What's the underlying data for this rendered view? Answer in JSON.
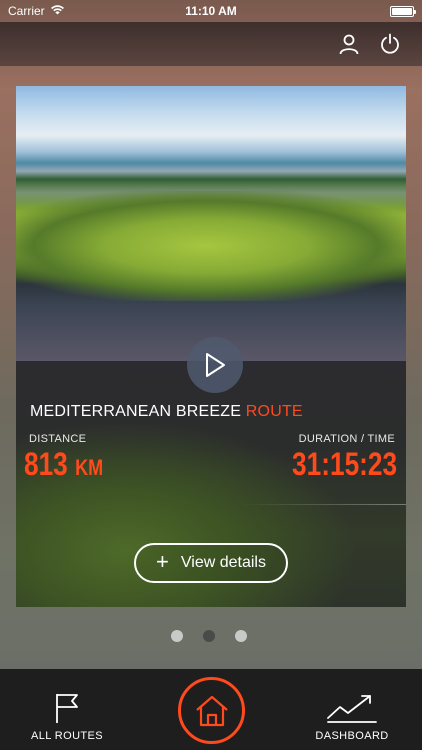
{
  "status_bar": {
    "carrier": "Carrier",
    "time": "11:10 AM"
  },
  "header": {
    "profile_icon": "person-icon",
    "power_icon": "power-icon"
  },
  "card": {
    "route_name": "MEDITERRANEAN BREEZE",
    "route_suffix": "ROUTE",
    "distance_label": "DISTANCE",
    "distance_value": "813",
    "distance_unit": "KM",
    "duration_label": "DURATION / TIME",
    "duration_value": "31:15:23",
    "details_label": "View details",
    "play_icon": "play-icon"
  },
  "pager": {
    "count": 3,
    "active_index": 1
  },
  "tabs": {
    "routes_label": "ALL ROUTES",
    "dashboard_label": "DASHBOARD",
    "home_icon": "home-icon"
  },
  "colors": {
    "accent": "#ff4a1c",
    "tab_bar": "#1e1e1f"
  }
}
